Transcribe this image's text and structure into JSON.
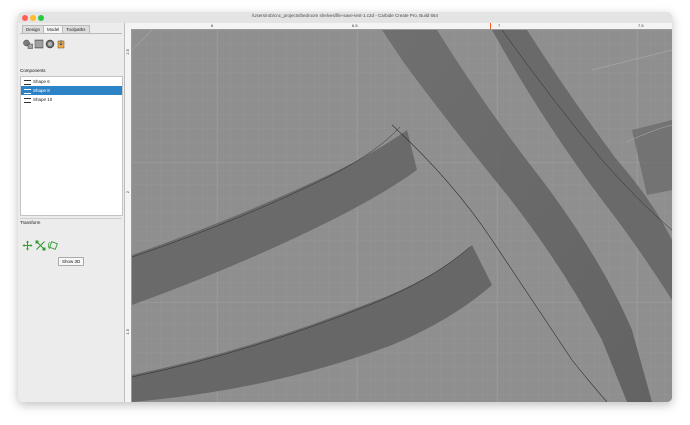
{
  "window": {
    "title": "/Users/rob/cnc_projects/bedroom shelves/file-save-test-1.c2d - Carbide Create Pro, Build 654"
  },
  "tabs": [
    {
      "label": "Design"
    },
    {
      "label": "Model",
      "active": true
    },
    {
      "label": "Toolpaths"
    }
  ],
  "tools": [
    {
      "icon": "add-shapes-icon"
    },
    {
      "icon": "texture-icon"
    },
    {
      "icon": "sphere-icon"
    },
    {
      "icon": "import-model-icon"
    }
  ],
  "components": {
    "label": "Components",
    "items": [
      {
        "label": "Shape 6",
        "selected": false
      },
      {
        "label": "Shape 8",
        "selected": true
      },
      {
        "label": "Shape 10",
        "selected": false
      }
    ]
  },
  "transform": {
    "label": "Transform",
    "buttons": [
      {
        "icon": "move-icon"
      },
      {
        "icon": "scale-icon"
      },
      {
        "icon": "rotate-icon"
      }
    ],
    "show3d_label": "Show 3D"
  },
  "rulers": {
    "top": [
      "6",
      "6.5",
      "7",
      "7.5"
    ],
    "left": [
      "2.5",
      "2",
      "1.5"
    ]
  },
  "colors": {
    "selection": "#2c84c7",
    "background": "#8f8f8f",
    "band": "#5f5f5f",
    "origin_marker": "#ff5a1f"
  }
}
